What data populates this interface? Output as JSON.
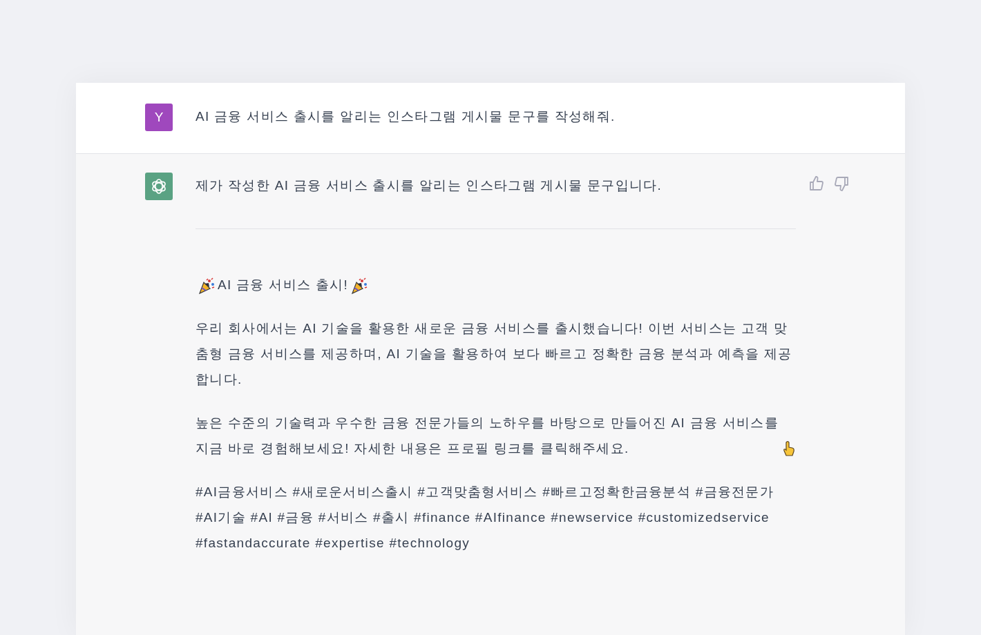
{
  "messages": [
    {
      "kind": "user",
      "avatar": "Y",
      "text": "AI 금융 서비스 출시를 알리는 인스타그램 게시물 문구를 작성해줘."
    },
    {
      "kind": "assistant",
      "text": "제가 작성한 AI 금융 서비스 출시를 알리는 인스타그램 게시물 문구입니다.",
      "blocks": [
        {
          "kind": "rule"
        },
        {
          "kind": "paragraph",
          "party_popper_icons": true,
          "text": "AI 금융 서비스 출시!"
        },
        {
          "kind": "paragraph",
          "text": "우리 회사에서는 AI 기술을 활용한 새로운 금융 서비스를 출시했습니다! 이번 서비스는 고객 맞춤형 금융 서비스를 제공하며, AI 기술을 활용하여 보다 빠르고 정확한 금융 분석과 예측을 제공합니다."
        },
        {
          "kind": "paragraph",
          "text": "높은 수준의 기술력과 우수한 금융 전문가들의 노하우를 바탕으로 만들어진 AI 금융 서비스를 지금 바로 경험해보세요! 자세한 내용은 프로필 링크를 클릭해주세요.",
          "pointing_hand_icon": true
        },
        {
          "kind": "paragraph",
          "text": "#AI금융서비스 #새로운서비스출시 #고객맞춤형서비스 #빠르고정확한금융분석 #금융전문가 #AI기술 #AI #금융 #서비스 #출시 #finance #AIfinance #newservice #customizedservice #fastandaccurate #expertise #technology"
        }
      ]
    }
  ]
}
